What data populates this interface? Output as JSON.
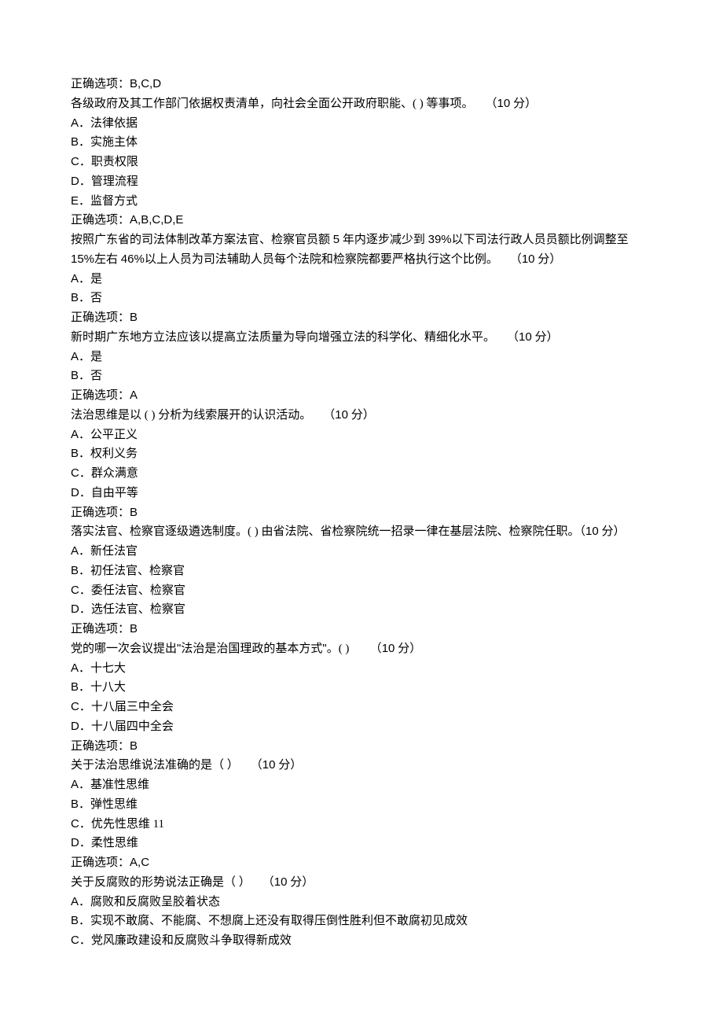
{
  "questions": [
    {
      "answer_prefix": "正确选项：",
      "answer": "B,C,D",
      "text": "各级政府及其工作部门依据权责清单，向社会全面公开政府职能、(   ) 等事项。　　（",
      "score": "10",
      "score_suffix": " 分）",
      "options": [
        {
          "label": "A",
          "text": "．法律依据"
        },
        {
          "label": "B",
          "text": "．实施主体"
        },
        {
          "label": "C",
          "text": "．职责权限"
        },
        {
          "label": "D",
          "text": "．管理流程"
        },
        {
          "label": "E",
          "text": "．监督方式"
        }
      ],
      "final_answer_prefix": "正确选项：",
      "final_answer": "A,B,C,D,E"
    },
    {
      "text": "按照广东省的司法体制改革方案法官、检察官员额 ",
      "mid1": "5",
      "text2": " 年内逐步减少到 ",
      "mid2": "39%",
      "text3": "以下司法行政人员员额比例调整至 ",
      "mid3": "15%",
      "text4": "左右 ",
      "mid4": "46%",
      "text5": "以上人员为司法辅助人员每个法院和检察院都要严格执行这个比例。　　（",
      "score": "10",
      "score_suffix": " 分）",
      "options": [
        {
          "label": "A",
          "text": "．是"
        },
        {
          "label": "B",
          "text": "．否"
        }
      ],
      "final_answer_prefix": "正确选项：",
      "final_answer": "B"
    },
    {
      "text": "新时期广东地方立法应该以提高立法质量为导向增强立法的科学化、精细化水平。　　（",
      "score": "10",
      "score_suffix": " 分）",
      "options": [
        {
          "label": "A",
          "text": "．是"
        },
        {
          "label": "B",
          "text": "．否"
        }
      ],
      "final_answer_prefix": "正确选项：",
      "final_answer": "A"
    },
    {
      "text": "法治思维是以 (  ) 分析为线索展开的认识活动。　　（",
      "score": "10",
      "score_suffix": " 分）",
      "options": [
        {
          "label": "A",
          "text": "．公平正义"
        },
        {
          "label": "B",
          "text": "．权利义务"
        },
        {
          "label": "C",
          "text": "．群众满意"
        },
        {
          "label": "D",
          "text": "．自由平等"
        }
      ],
      "final_answer_prefix": "正确选项：",
      "final_answer": "B"
    },
    {
      "text": "落实法官、检察官逐级遴选制度。(  ) 由省法院、省检察院统一招录一律在基层法院、检察院任职。（",
      "score": "10",
      "score_suffix": " 分）",
      "options": [
        {
          "label": "A",
          "text": "．新任法官"
        },
        {
          "label": "B",
          "text": "．初任法官、检察官"
        },
        {
          "label": "C",
          "text": "．委任法官、检察官"
        },
        {
          "label": "D",
          "text": "．选任法官、检察官"
        }
      ],
      "final_answer_prefix": "正确选项：",
      "final_answer": "B"
    },
    {
      "text_pre": "党的哪一次会议提出",
      "quote_open": "\"",
      "quote_text": "法治是治国理政的基本方式",
      "quote_close": "\"",
      "text_post": "。(  ) 　　（",
      "score": "10",
      "score_suffix": " 分）",
      "options": [
        {
          "label": "A",
          "text": "．十七大"
        },
        {
          "label": "B",
          "text": "．十八大"
        },
        {
          "label": "C",
          "text": "．十八届三中全会"
        },
        {
          "label": "D",
          "text": "．十八届四中全会"
        }
      ],
      "final_answer_prefix": "正确选项：",
      "final_answer": "B"
    },
    {
      "text": "关于法治思维说法准确的是（  ）　　（",
      "score": "10",
      "score_suffix": " 分）",
      "options": [
        {
          "label": "A",
          "text": "．基准性思维"
        },
        {
          "label": "B",
          "text": "．弹性思维"
        },
        {
          "label": "C",
          "text": "．优先性思维 11"
        },
        {
          "label": "D",
          "text": "．柔性思维"
        }
      ],
      "final_answer_prefix": "正确选项：",
      "final_answer": "A,C"
    },
    {
      "text": "关于反腐败的形势说法正确是（  ）　　（",
      "score": "10",
      "score_suffix": " 分）",
      "options": [
        {
          "label": "A",
          "text": "．腐败和反腐败呈胶着状态"
        },
        {
          "label": "B",
          "text": "．实现不敢腐、不能腐、不想腐上还没有取得压倒性胜利但不敢腐初见成效"
        },
        {
          "label": "C",
          "text": "．党风廉政建设和反腐败斗争取得新成效"
        }
      ]
    }
  ]
}
